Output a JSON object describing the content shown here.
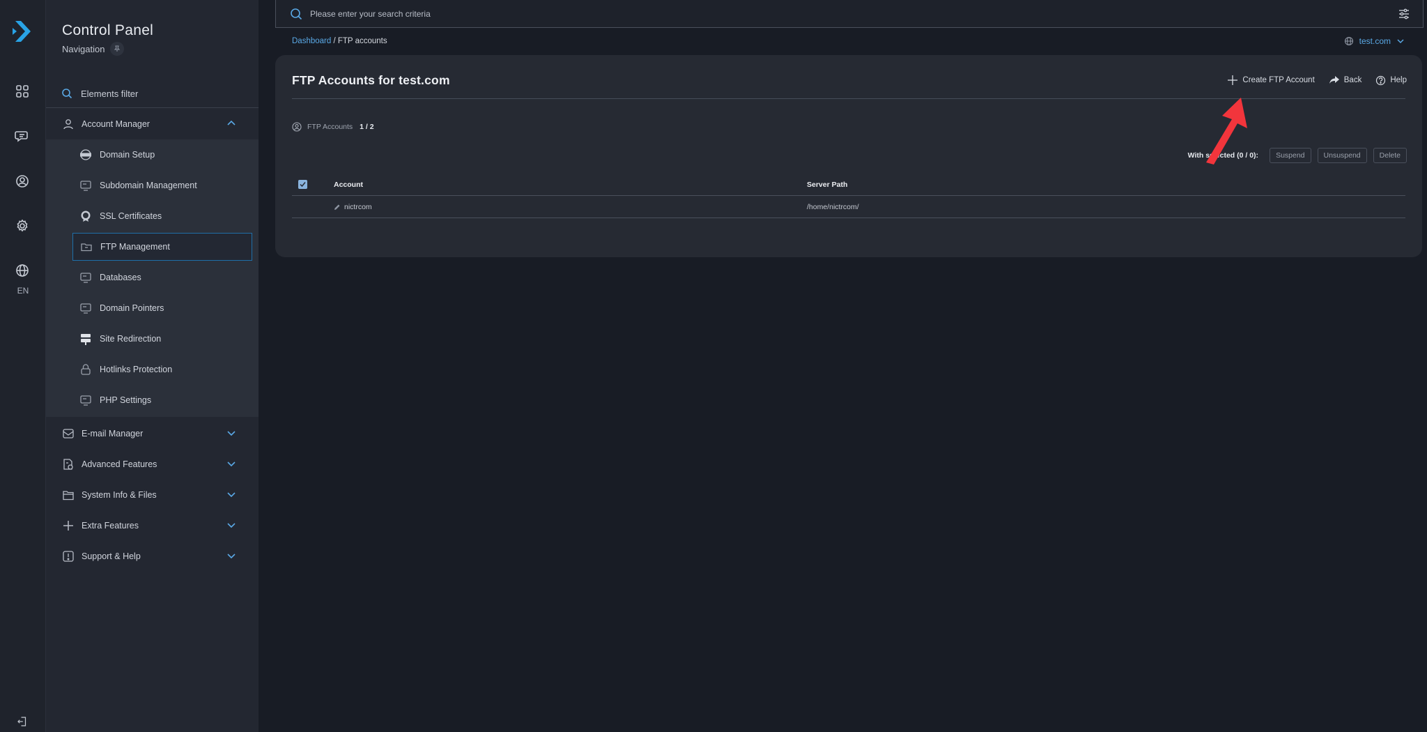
{
  "rail": {
    "icons": [
      "apps-icon",
      "chat-icon",
      "user-circle-icon",
      "gear-icon",
      "globe-icon"
    ],
    "language": "EN",
    "logout_icon": "logout-icon"
  },
  "nav": {
    "title": "Control Panel",
    "subtitle": "Navigation",
    "filter_placeholder": "Elements filter",
    "sections": [
      {
        "label": "Account Manager",
        "icon": "user-icon",
        "expanded": true
      },
      {
        "label": "E-mail Manager",
        "icon": "mail-icon",
        "expanded": false
      },
      {
        "label": "Advanced Features",
        "icon": "advanced-icon",
        "expanded": false
      },
      {
        "label": "System Info & Files",
        "icon": "folder-icon",
        "expanded": false
      },
      {
        "label": "Extra Features",
        "icon": "plus-icon",
        "expanded": false
      },
      {
        "label": "Support & Help",
        "icon": "info-icon",
        "expanded": false
      }
    ],
    "account_items": [
      {
        "label": "Domain Setup",
        "icon": "www-icon"
      },
      {
        "label": "Subdomain Management",
        "icon": "monitor-icon"
      },
      {
        "label": "SSL Certificates",
        "icon": "ssl-badge-icon"
      },
      {
        "label": "FTP Management",
        "icon": "ftp-folder-icon",
        "active": true
      },
      {
        "label": "Databases",
        "icon": "monitor-icon"
      },
      {
        "label": "Domain Pointers",
        "icon": "monitor-icon"
      },
      {
        "label": "Site Redirection",
        "icon": "signpost-icon"
      },
      {
        "label": "Hotlinks Protection",
        "icon": "lock-icon"
      },
      {
        "label": "PHP Settings",
        "icon": "monitor-icon"
      }
    ]
  },
  "search": {
    "placeholder": "Please enter your search criteria"
  },
  "breadcrumb": {
    "home": "Dashboard",
    "separator": " / ",
    "current": "FTP accounts"
  },
  "domain_selector": {
    "value": "test.com"
  },
  "page": {
    "title": "FTP Accounts for test.com",
    "actions": {
      "create": "Create FTP Account",
      "back": "Back",
      "help": "Help"
    },
    "count_label": "FTP Accounts",
    "count_value": "1 / 2",
    "bulk": {
      "label": "With selected (0 / 0):",
      "suspend": "Suspend",
      "unsuspend": "Unsuspend",
      "delete": "Delete"
    },
    "table": {
      "columns": [
        "Account",
        "Server Path"
      ],
      "rows": [
        {
          "account": "nictrcom",
          "server_path": "/home/nictrcom/"
        }
      ]
    }
  },
  "colors": {
    "accent": "#5aa9e6",
    "annotation_arrow": "#f2353c",
    "background": "#181c25",
    "card": "#262a33"
  }
}
